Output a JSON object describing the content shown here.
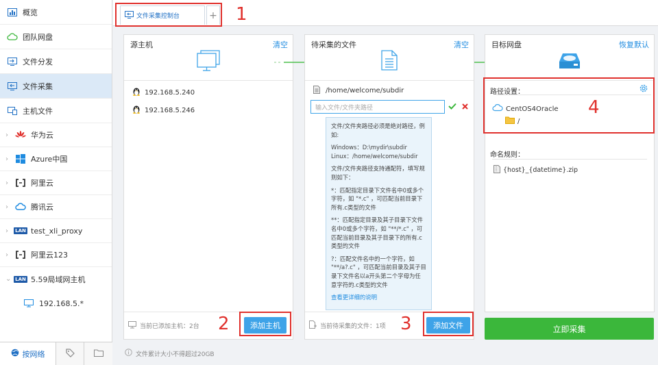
{
  "sidebar": {
    "items": [
      {
        "label": "概览",
        "icon": "overview-icon"
      },
      {
        "label": "团队网盘",
        "icon": "cloud-drive-icon"
      },
      {
        "label": "文件分发",
        "icon": "distribute-icon"
      },
      {
        "label": "文件采集",
        "icon": "collect-icon"
      },
      {
        "label": "主机文件",
        "icon": "host-file-icon"
      }
    ],
    "clouds": [
      {
        "label": "华为云",
        "icon": "huawei-icon"
      },
      {
        "label": "Azure中国",
        "icon": "windows-icon"
      },
      {
        "label": "阿里云",
        "icon": "aliyun-icon"
      },
      {
        "label": "腾讯云",
        "icon": "tencent-cloud-icon"
      },
      {
        "label": "test_xli_proxy",
        "icon": "lan-icon"
      },
      {
        "label": "阿里云123",
        "icon": "aliyun-icon"
      },
      {
        "label": "5.59局域网主机",
        "icon": "lan-icon"
      }
    ],
    "sub_host": "192.168.5.*",
    "bottom_tab": "按网络",
    "lan_badge": "LAN"
  },
  "tabs": {
    "active": "文件采集控制台",
    "add": "+"
  },
  "annotations": [
    "1",
    "2",
    "3",
    "4"
  ],
  "source": {
    "title": "源主机",
    "clear": "清空",
    "hosts": [
      "192.168.5.240",
      "192.168.5.246"
    ],
    "footer": "当前已添加主机：2台",
    "add_button": "添加主机"
  },
  "files": {
    "title": "待采集的文件",
    "clear": "清空",
    "path": "/home/welcome/subdir",
    "input_placeholder": "输入文件/文件夹路径",
    "tip": {
      "p1": "文件/文件夹路径必须是绝对路径，例如:",
      "p2a": "Windows：D:\\mydir\\subdir",
      "p2b": "Linux：/home/welcome/subdir",
      "p3": "文件/文件夹路径支持通配符，填写规则如下：",
      "p4": "*：匹配指定目录下文件名中0或多个字符，如 \"*.c\" ，可匹配当前目录下所有.c类型的文件",
      "p5": "**：匹配指定目录及其子目录下文件名中0或多个字符，如 \"**/*.c\" ，可匹配当前目录及其子目录下的所有.c类型的文件",
      "p6": "?：匹配文件名中的一个字符，如 \"**/a?.c\" ，可匹配当前目录及其子目录下文件名以a开头第二个字母为任意字符的.c类型的文件",
      "link": "查看更详细的说明"
    },
    "footer": "当前待采集的文件：1项",
    "add_button": "添加文件"
  },
  "target": {
    "title": "目标网盘",
    "reset": "恢复默认",
    "path_label": "路径设置：",
    "drive_name": "CentOS4Oracle",
    "folder": "/",
    "naming_label": "命名规则：",
    "naming_value": "{host}_{datetime}.zip",
    "collect_button": "立即采集"
  },
  "bottom_note": "文件累计大小不得超过20GB",
  "colors": {
    "accent": "#3ea3e8",
    "link": "#1e8be0",
    "green": "#3bb73b",
    "annotation_red": "#e0302c"
  }
}
